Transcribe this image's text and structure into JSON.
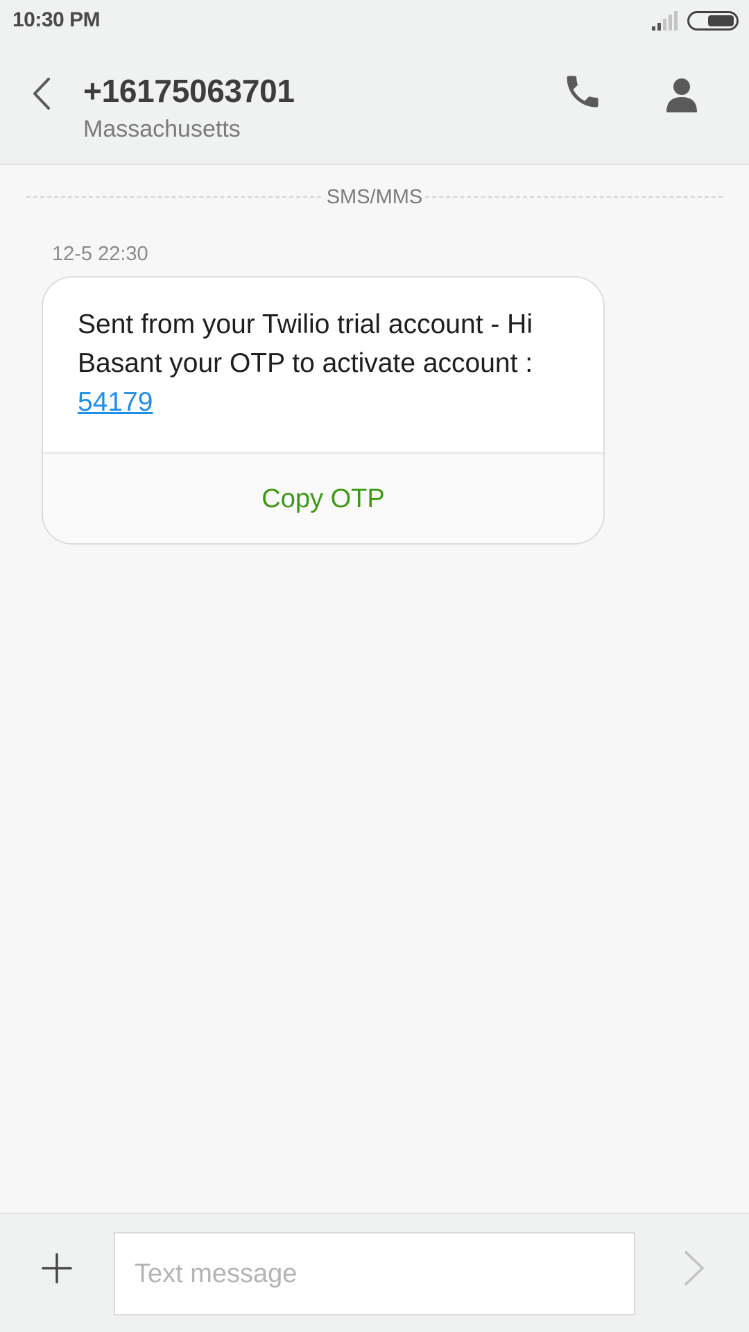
{
  "status_bar": {
    "time": "10:30 PM",
    "signal_icon": "signal-icon",
    "battery_icon": "battery-icon"
  },
  "header": {
    "back_icon": "chevron-left-icon",
    "contact_number": "+16175063701",
    "contact_location": "Massachusetts",
    "call_icon": "phone-icon",
    "contact_icon": "person-icon"
  },
  "thread": {
    "channel_label": "SMS/MMS",
    "messages": [
      {
        "timestamp": "12-5 22:30",
        "text": "Sent from your Twilio trial account - Hi Basant your OTP to activate account : ",
        "otp": "54179",
        "action_label": "Copy OTP"
      }
    ]
  },
  "composer": {
    "attach_icon": "plus-icon",
    "placeholder": "Text message",
    "value": "",
    "send_icon": "chevron-right-icon"
  },
  "colors": {
    "link": "#1f8fe8",
    "action": "#3c9a14",
    "header_bg": "#f0f1f1",
    "page_bg": "#f7f7f7"
  }
}
